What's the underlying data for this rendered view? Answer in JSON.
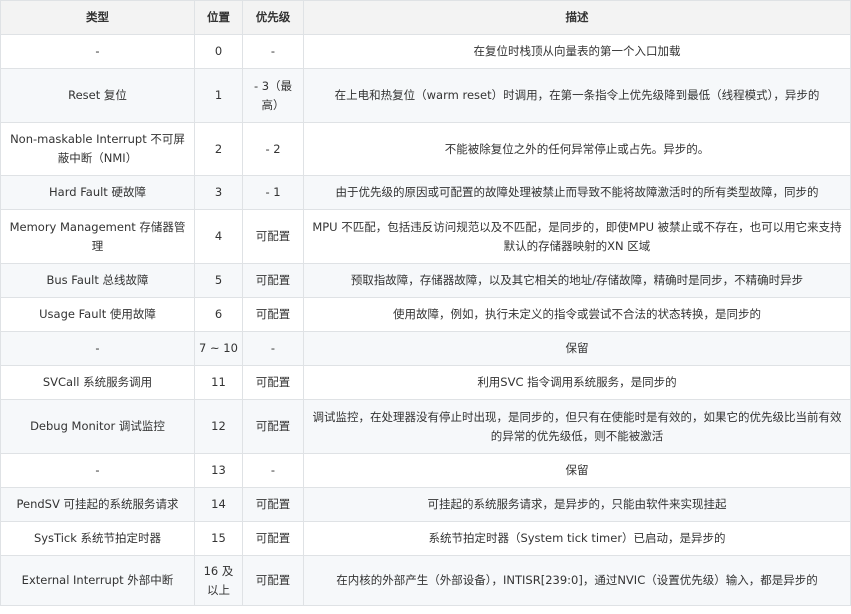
{
  "table": {
    "headers": [
      "类型",
      "位置",
      "优先级",
      "描述"
    ],
    "rows": [
      {
        "type": "-",
        "pos": "0",
        "priority": "-",
        "desc": "在复位时栈顶从向量表的第一个入口加载"
      },
      {
        "type": "Reset 复位",
        "pos": "1",
        "priority": "- 3（最高）",
        "desc": "在上电和热复位（warm reset）时调用，在第一条指令上优先级降到最低（线程模式），异步的"
      },
      {
        "type": "Non-maskable Interrupt 不可屏蔽中断（NMI）",
        "pos": "2",
        "priority": "- 2",
        "desc": "不能被除复位之外的任何异常停止或占先。异步的。"
      },
      {
        "type": "Hard Fault 硬故障",
        "pos": "3",
        "priority": "- 1",
        "desc": "由于优先级的原因或可配置的故障处理被禁止而导致不能将故障激活时的所有类型故障，同步的"
      },
      {
        "type": "Memory Management 存储器管理",
        "pos": "4",
        "priority": "可配置",
        "desc": "MPU 不匹配，包括违反访问规范以及不匹配，是同步的，即使MPU 被禁止或不存在，也可以用它来支持默认的存储器映射的XN 区域"
      },
      {
        "type": "Bus Fault 总线故障",
        "pos": "5",
        "priority": "可配置",
        "desc": "预取指故障，存储器故障，以及其它相关的地址/存储故障，精确时是同步，不精确时异步"
      },
      {
        "type": "Usage Fault 使用故障",
        "pos": "6",
        "priority": "可配置",
        "desc": "使用故障，例如，执行未定义的指令或尝试不合法的状态转换，是同步的"
      },
      {
        "type": "-",
        "pos": "7 ~ 10",
        "priority": "-",
        "desc": "保留"
      },
      {
        "type": "SVCall 系统服务调用",
        "pos": "11",
        "priority": "可配置",
        "desc": "利用SVC 指令调用系统服务，是同步的"
      },
      {
        "type": "Debug Monitor 调试监控",
        "pos": "12",
        "priority": "可配置",
        "desc": "调试监控，在处理器没有停止时出现，是同步的，但只有在使能时是有效的，如果它的优先级比当前有效的异常的优先级低，则不能被激活"
      },
      {
        "type": "-",
        "pos": "13",
        "priority": "-",
        "desc": "保留"
      },
      {
        "type": "PendSV 可挂起的系统服务请求",
        "pos": "14",
        "priority": "可配置",
        "desc": "可挂起的系统服务请求，是异步的，只能由软件来实现挂起"
      },
      {
        "type": "SysTick 系统节拍定时器",
        "pos": "15",
        "priority": "可配置",
        "desc": "系统节拍定时器（System tick timer）已启动，是异步的"
      },
      {
        "type": "External Interrupt 外部中断",
        "pos": "16 及以上",
        "priority": "可配置",
        "desc": "在内核的外部产生（外部设备），INTISR[239:0]，通过NVIC（设置优先级）输入，都是异步的"
      }
    ]
  }
}
